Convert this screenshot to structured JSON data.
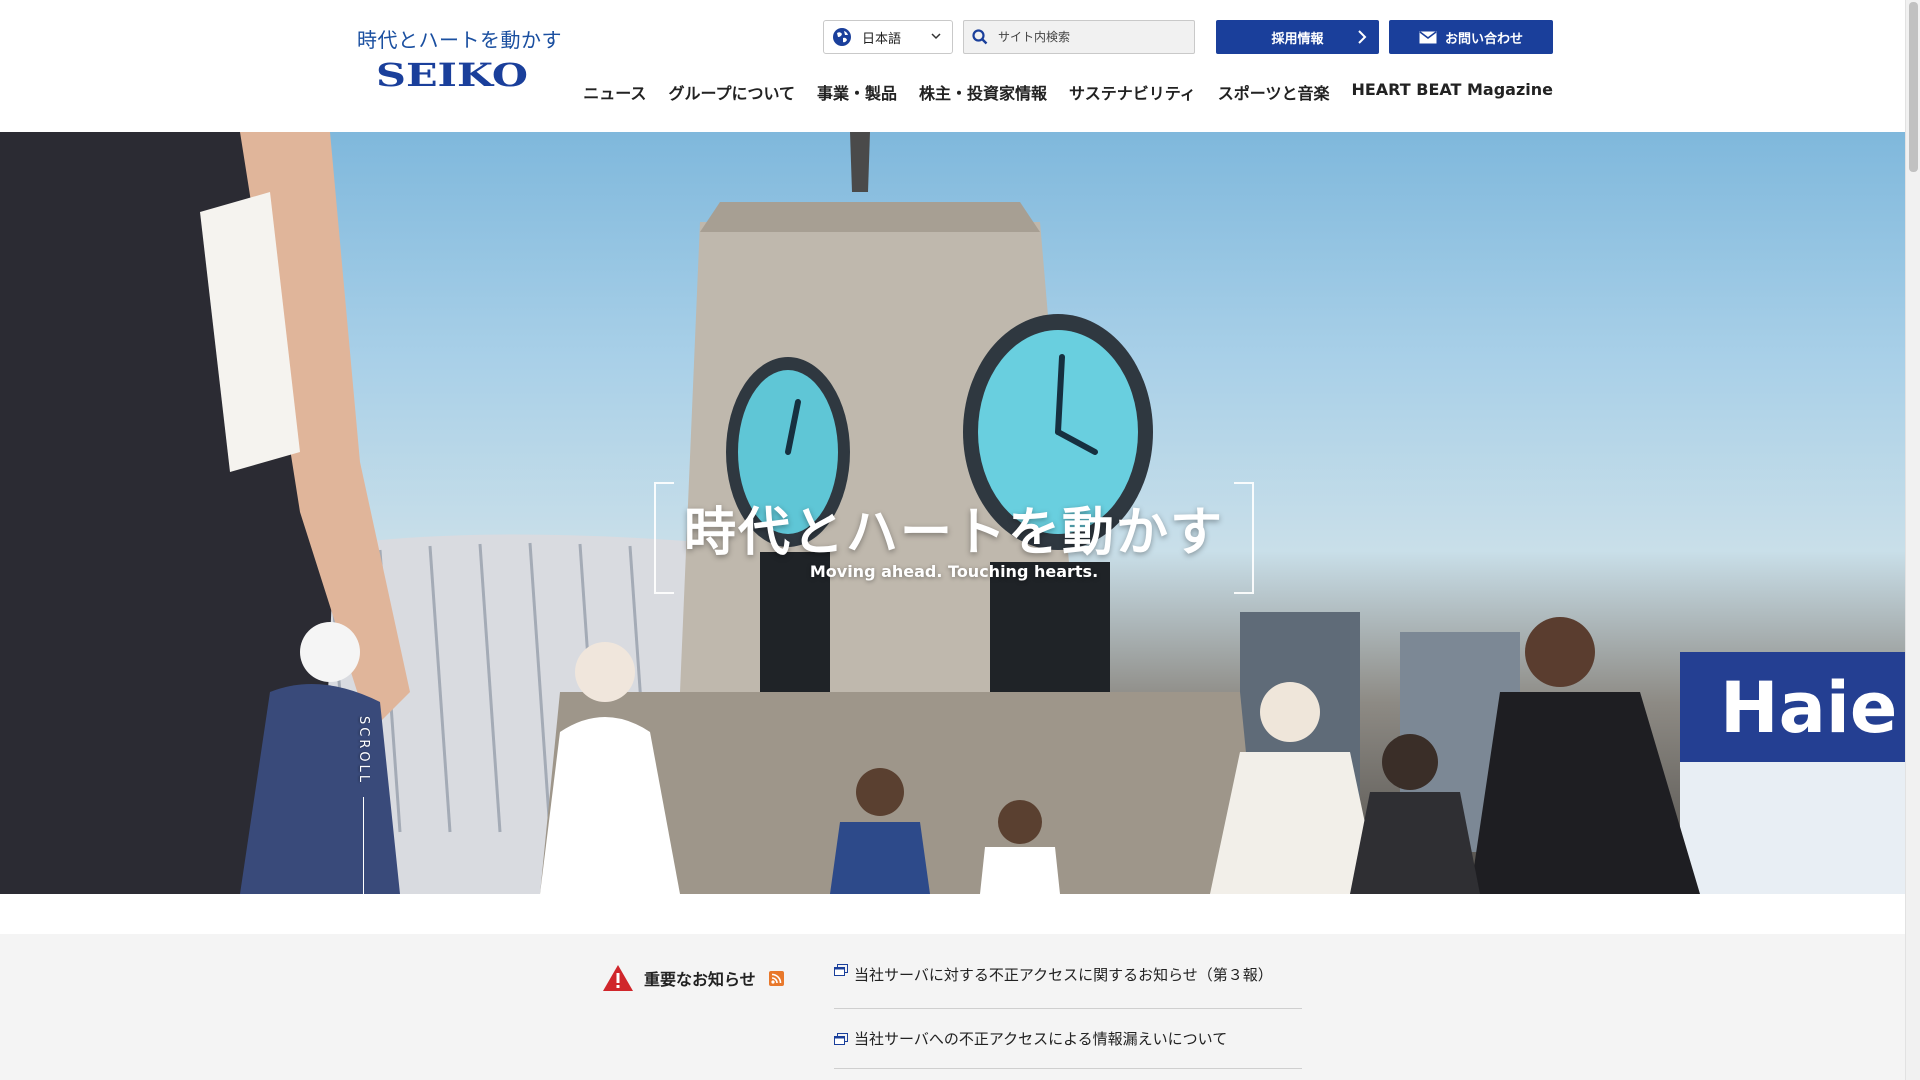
{
  "header": {
    "tagline": "時代とハートを動かす",
    "logo_text": "SEIKO",
    "language": {
      "label": "日本語"
    },
    "search": {
      "placeholder": "サイト内検索"
    },
    "recruit_label": "採用情報",
    "contact_label": "お問い合わせ",
    "nav": [
      {
        "label": "ニュース"
      },
      {
        "label": "グループについて"
      },
      {
        "label": "事業・製品"
      },
      {
        "label": "株主・投資家情報"
      },
      {
        "label": "サステナビリティ"
      },
      {
        "label": "スポーツと音楽"
      },
      {
        "label": "HEART BEAT Magazine"
      }
    ]
  },
  "hero": {
    "title": "時代とハートを動かす",
    "subtitle": "Moving ahead. Touching hearts.",
    "scroll_label": "SCROLL"
  },
  "notices": {
    "heading": "重要なお知らせ",
    "items": [
      {
        "text": "当社サーバに対する不正アクセスに関するお知らせ（第３報）"
      },
      {
        "text": "当社サーバへの不正アクセスによる情報漏えいについて"
      }
    ]
  },
  "colors": {
    "brand_blue": "#1a3f9b",
    "tagline_blue": "#1a4fa0",
    "alert_red": "#d0262b",
    "rss_orange": "#e8782b"
  }
}
